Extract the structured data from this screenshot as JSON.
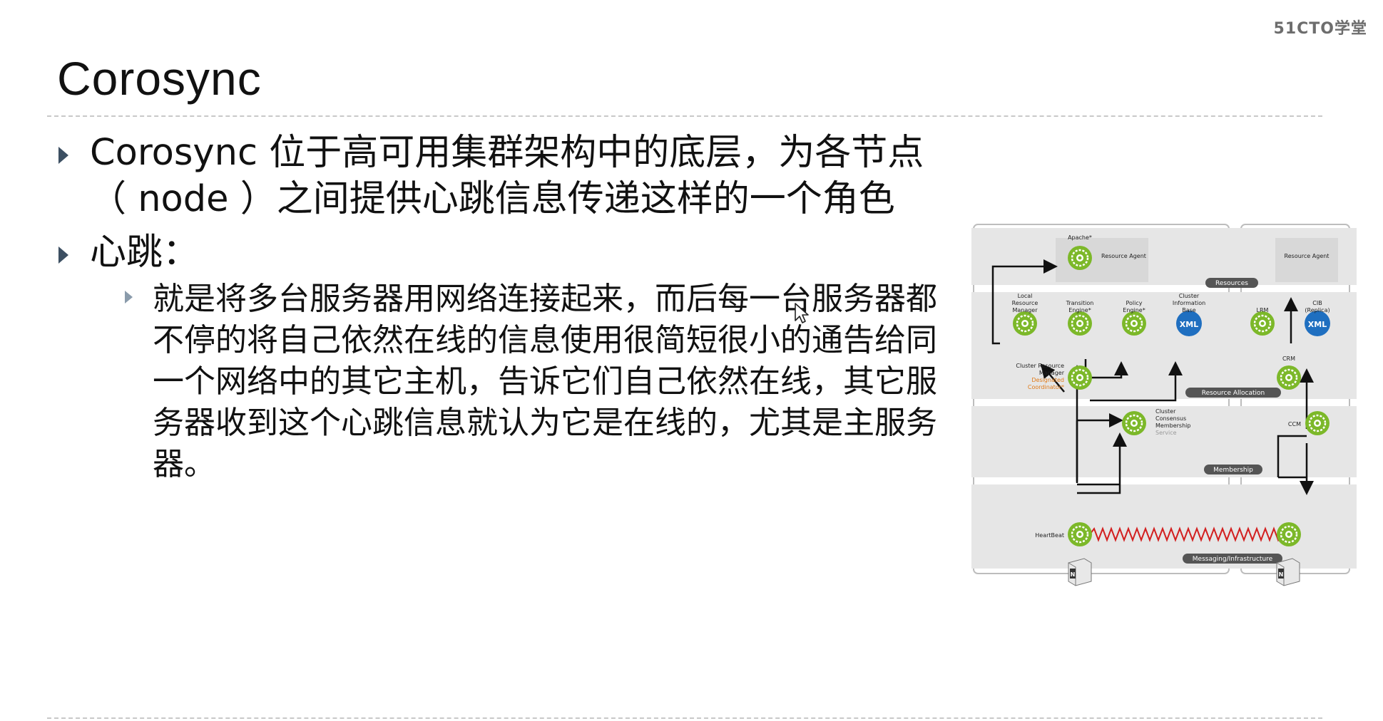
{
  "brand": "51CTO学堂",
  "title": "Corosync",
  "bullets": [
    {
      "text": " Corosync 位于高可用集群架构中的底层，为各节点（ node ）之间提供心跳信息传递这样的一个角色"
    },
    {
      "text": "心跳：",
      "sub": [
        {
          "text": "就是将多台服务器用网络连接起来，而后每一台服务器都不停的将自己依然在线的信息使用很简短很小的通告给同一个网络中的其它主机，告诉它们自己依然在线，其它服务器收到这个心跳信息就认为它是在线的，尤其是主服务器。"
        }
      ]
    }
  ],
  "diagram": {
    "labels": {
      "apache": "Apache*",
      "resource_agent_left": "Resource Agent",
      "resource_agent_right": "Resource Agent",
      "resources_band": "Resources",
      "local_rm_1": "Local",
      "local_rm_2": "Resource",
      "local_rm_3": "Manager",
      "te_1": "Transition",
      "te_2": "Engine*",
      "pe_1": "Policy",
      "pe_2": "Engine*",
      "cib_1": "Cluster",
      "cib_2": "Information",
      "cib_3": "Base",
      "lrm": "LRM",
      "cib_r1": "CIB",
      "cib_r2": "(Replica)",
      "crm": "CRM",
      "crm_l1": "Cluster Resource",
      "crm_l2": "Manager",
      "dc_1": "Designated",
      "dc_2": "Coordinator*",
      "res_alloc_band": "Resource Allocation",
      "ccm_l1": "Cluster",
      "ccm_l2": "Consensus",
      "ccm_l3": "Membership",
      "ccm_l4": "Service",
      "ccm": "CCM",
      "membership_band": "Membership",
      "heartbeat": "HeartBeat",
      "messaging_band": "Messaging/Infrastructure",
      "xml": "XML",
      "node_letter": "N"
    },
    "colors": {
      "gear": "#7cb829",
      "xml": "#1f6fc0",
      "heartbeat": "#d21f1f",
      "dc": "#e07a18"
    }
  }
}
